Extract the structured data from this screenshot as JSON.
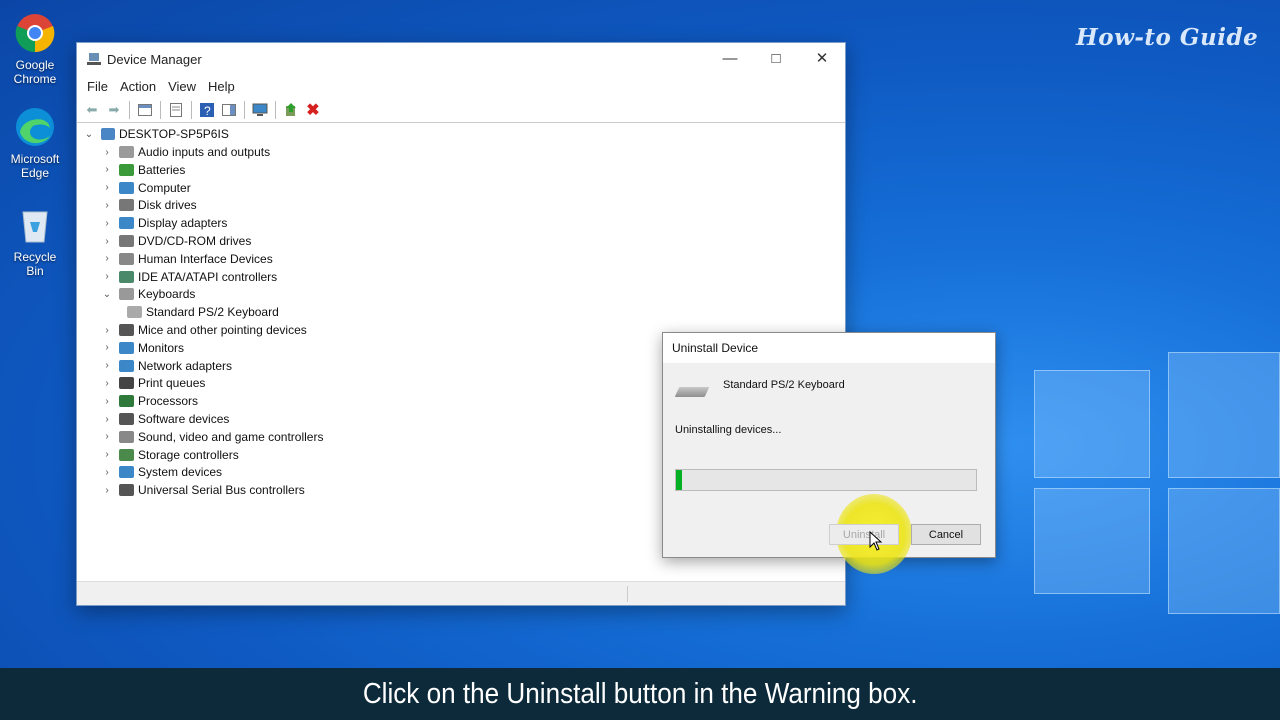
{
  "watermark": "How-to Guide",
  "desktop": {
    "icons": [
      {
        "label_1": "Google",
        "label_2": "Chrome"
      },
      {
        "label_1": "Microsoft",
        "label_2": "Edge"
      },
      {
        "label_1": "Recycle Bin"
      }
    ]
  },
  "window": {
    "title": "Device Manager",
    "menu": [
      "File",
      "Action",
      "View",
      "Help"
    ],
    "root": "DESKTOP-SP5P6IS",
    "categories": [
      "Audio inputs and outputs",
      "Batteries",
      "Computer",
      "Disk drives",
      "Display adapters",
      "DVD/CD-ROM drives",
      "Human Interface Devices",
      "IDE ATA/ATAPI controllers",
      "Keyboards",
      "Standard PS/2 Keyboard",
      "Mice and other pointing devices",
      "Monitors",
      "Network adapters",
      "Print queues",
      "Processors",
      "Software devices",
      "Sound, video and game controllers",
      "Storage controllers",
      "System devices",
      "Universal Serial Bus controllers"
    ]
  },
  "dialog": {
    "title": "Uninstall Device",
    "device": "Standard PS/2 Keyboard",
    "status": "Uninstalling devices...",
    "progress": 0.02,
    "uninstall_label": "Uninstall",
    "cancel_label": "Cancel"
  },
  "caption": "Click on the Uninstall button in the Warning box."
}
